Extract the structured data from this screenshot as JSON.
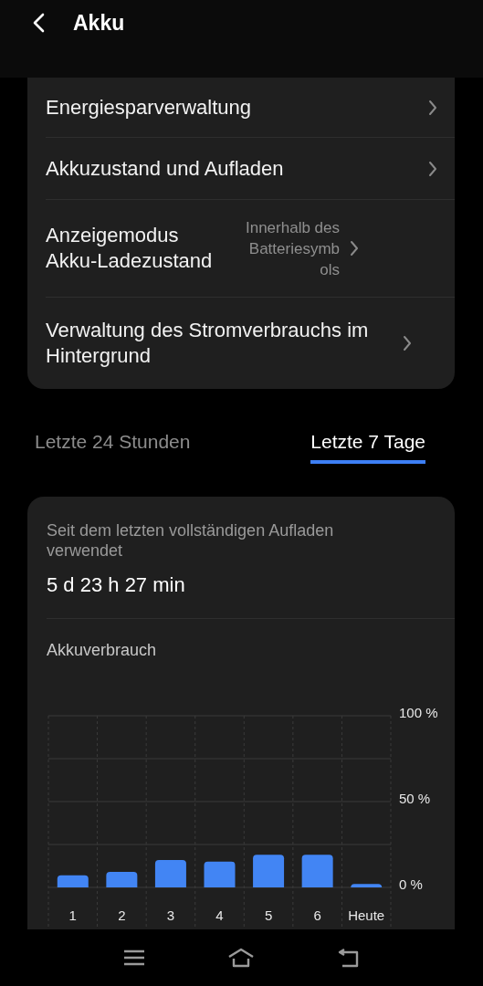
{
  "header": {
    "title": "Akku"
  },
  "settings": [
    {
      "title": "Energiesparverwaltung"
    },
    {
      "title": "Akkuzustand und Aufladen"
    },
    {
      "title": "Anzeigemodus Akku-Ladezustand",
      "value": "Innerhalb des Batteriesymb ols"
    },
    {
      "title": "Verwaltung des Stromverbrauchs im Hintergrund"
    }
  ],
  "tabs": [
    {
      "label": "Letzte 24 Stunden",
      "selected": false
    },
    {
      "label": "Letzte 7 Tage",
      "selected": true
    }
  ],
  "usage": {
    "caption": "Seit dem letzten vollständigen Aufladen verwendet",
    "duration": "5 d 23 h 27 min",
    "chart_title": "Akkuverbrauch",
    "chart_data": {
      "type": "bar",
      "categories": [
        "1",
        "2",
        "3",
        "4",
        "5",
        "6",
        "Heute"
      ],
      "values": [
        7,
        9,
        16,
        15,
        19,
        19,
        2
      ],
      "ylim": [
        0,
        100
      ],
      "yticks": [
        {
          "value": 0,
          "label": "0 %"
        },
        {
          "value": 50,
          "label": "50 %"
        },
        {
          "value": 100,
          "label": "100 %"
        }
      ]
    }
  }
}
